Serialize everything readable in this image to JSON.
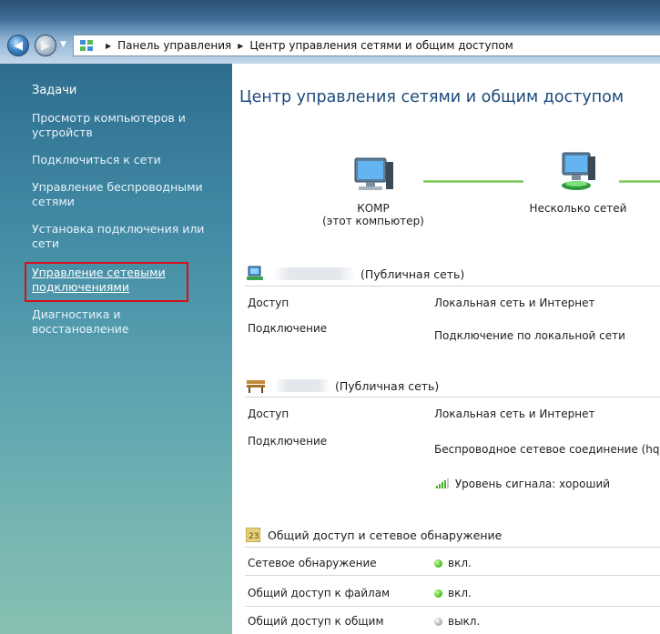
{
  "address_bar": {
    "crumbs": [
      "Панель управления",
      "Центр управления сетями и общим доступом"
    ]
  },
  "sidebar": {
    "title": "Задачи",
    "items": [
      {
        "label": "Просмотр компьютеров и устройств"
      },
      {
        "label": "Подключиться к сети"
      },
      {
        "label": "Управление беспроводными сетями"
      },
      {
        "label": "Установка подключения или сети"
      },
      {
        "label": "Управление сетевыми подключениями",
        "highlighted": true
      },
      {
        "label": "Диагностика и восстановление"
      }
    ]
  },
  "main": {
    "title": "Центр управления сетями и общим доступом",
    "map": {
      "computer_name": "КОМР",
      "computer_sub": "(этот компьютер)",
      "networks_label": "Несколько сетей"
    },
    "network1": {
      "type": "(Публичная сеть)",
      "rows": [
        {
          "label": "Доступ",
          "value": "Локальная сеть и Интернет"
        },
        {
          "label": "Подключение",
          "value": "Подключение по локальной сети"
        }
      ]
    },
    "network2": {
      "type": "(Публичная сеть)",
      "rows": [
        {
          "label": "Доступ",
          "value": "Локальная сеть и Интернет"
        },
        {
          "label": "Подключение",
          "value": "Беспроводное сетевое соединение (hq"
        }
      ],
      "signal": "Уровень сигнала: хороший"
    },
    "sharing": {
      "title": "Общий доступ и сетевое обнаружение",
      "rows": [
        {
          "label": "Сетевое обнаружение",
          "value": "вкл.",
          "state": "on"
        },
        {
          "label": "Общий доступ к файлам",
          "value": "вкл.",
          "state": "on"
        },
        {
          "label": "Общий доступ к общим",
          "value": "выкл.",
          "state": "off"
        }
      ]
    }
  },
  "colors": {
    "title_blue": "#1d4a7c",
    "highlight_red": "#d6101a",
    "status_on": "#3eb51a",
    "status_off": "#a8a8a8"
  }
}
